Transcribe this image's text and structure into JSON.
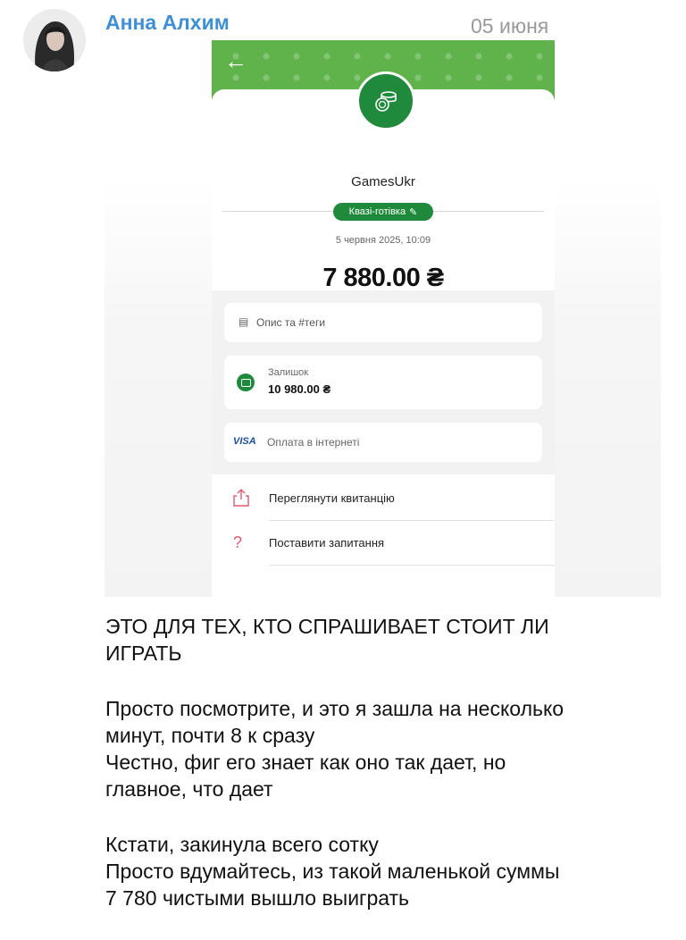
{
  "chat": {
    "sender_name": "Анна Алхим",
    "date": "05 июня"
  },
  "receipt": {
    "merchant": "GamesUkr",
    "category": "Квазі-готівка",
    "datetime": "5 червня 2025, 10:09",
    "amount": "7 880.00 ₴",
    "description_placeholder": "Опис та #теги",
    "balance_label": "Залишок",
    "balance_value": "10 980.00 ₴",
    "card_brand": "VISA",
    "payment_type": "Оплата в інтернеті",
    "actions": [
      {
        "label": "Переглянути квитанцію",
        "icon": "share-icon"
      },
      {
        "label": "Поставити запитання",
        "icon": "question-icon"
      }
    ],
    "accent_color": "#1f8a3b",
    "header_color": "#5fb34a"
  },
  "message": {
    "paragraphs": [
      [
        "ЭТО ДЛЯ ТЕХ, КТО СПРАШИВАЕТ СТОИТ ЛИ",
        "ИГРАТЬ"
      ],
      [
        "Просто посмотрите, и это я зашла на несколько",
        "минут, почти 8 к  сразу",
        "Честно, фиг его знает как оно так дает, но",
        "главное, что дает"
      ],
      [
        "Кстати, закинула всего сотку",
        "Просто вдумайтесь, из такой маленькой суммы",
        "7 780 чистыми вышло выиграть"
      ]
    ]
  }
}
